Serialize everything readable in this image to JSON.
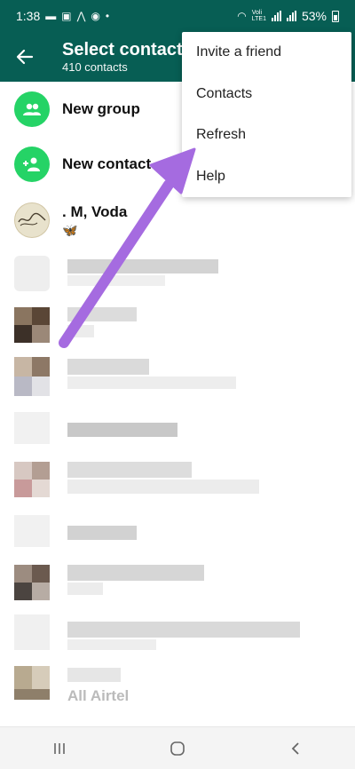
{
  "status_bar": {
    "time": "1:38",
    "network_label": "Voli\nLTE1",
    "battery": "53%"
  },
  "app_bar": {
    "back_icon": "arrow-back-icon",
    "title": "Select contact",
    "subtitle": "410 contacts"
  },
  "list": {
    "new_group": "New group",
    "new_contact": "New contact",
    "first_contact": {
      "name": ". M, Voda",
      "status": "🦋"
    },
    "last_partial_name": "All Airtel"
  },
  "menu": {
    "items": [
      {
        "label": "Invite a friend"
      },
      {
        "label": "Contacts"
      },
      {
        "label": "Refresh"
      },
      {
        "label": "Help"
      }
    ]
  },
  "nav_bar": {
    "recents_icon": "recents-icon",
    "home_icon": "home-icon",
    "back_icon": "nav-back-icon"
  },
  "colors": {
    "header": "#075e54",
    "accent_green": "#25d366",
    "arrow": "#a56be0"
  }
}
